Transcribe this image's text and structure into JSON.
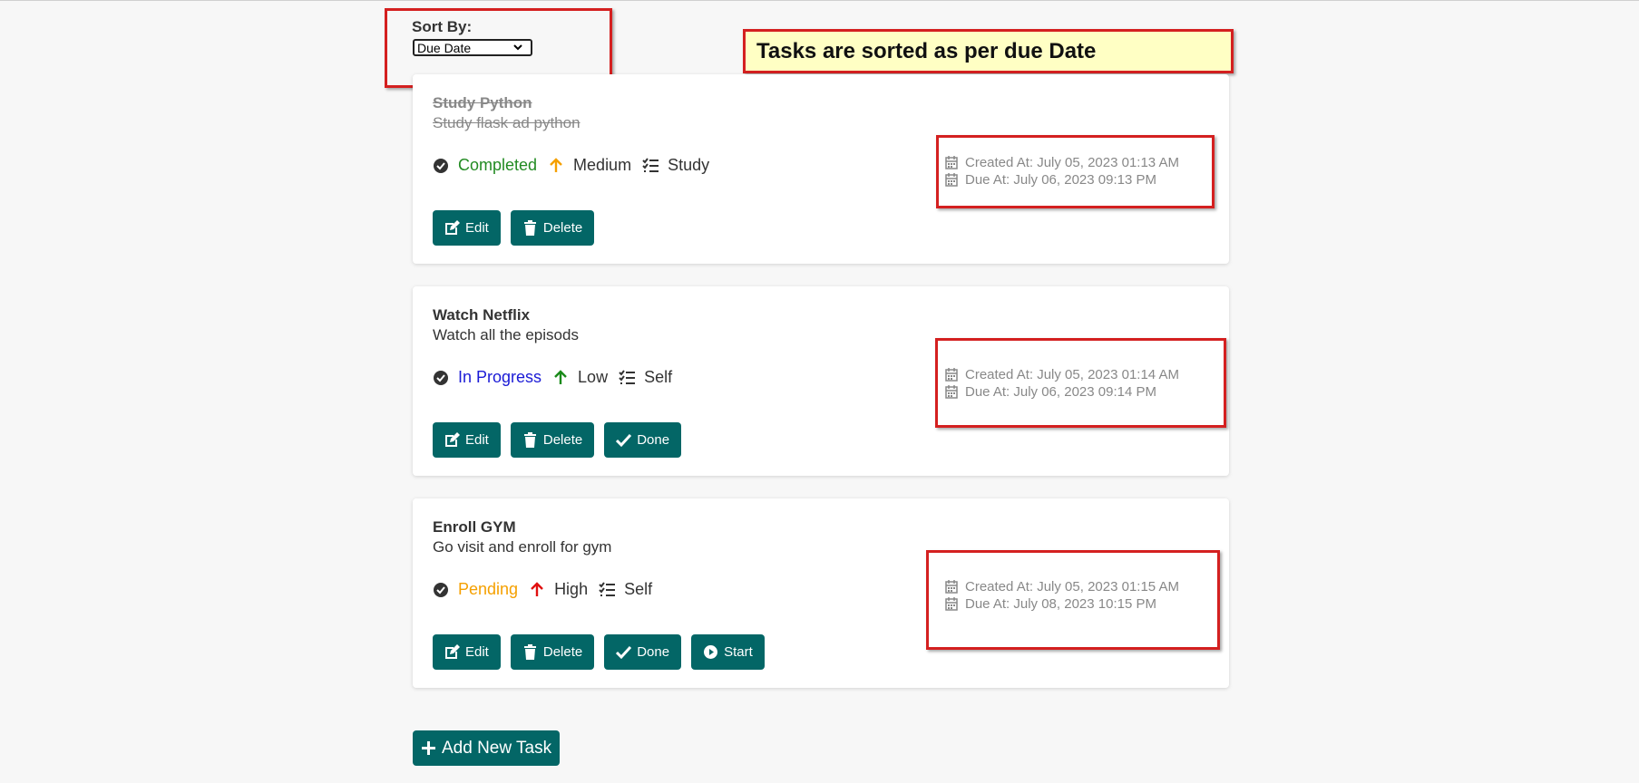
{
  "sort": {
    "label": "Sort By:",
    "selected": "Due Date"
  },
  "annotation": {
    "text": "Tasks are sorted as per due Date"
  },
  "tasks": [
    {
      "title": "Study Python",
      "description": "Study flask ad python",
      "status": "Completed",
      "status_color": "#228b22",
      "priority": "Medium",
      "priority_color": "#f5a000",
      "category": "Study",
      "created": "Created At: July 05, 2023 01:13 AM",
      "due": "Due At: July 06, 2023 09:13 PM",
      "buttons": {
        "edit": "Edit",
        "delete": "Delete"
      }
    },
    {
      "title": "Watch Netflix",
      "description": "Watch all the episods",
      "status": "In Progress",
      "status_color": "#1a1ad6",
      "priority": "Low",
      "priority_color": "#1a8a1a",
      "category": "Self",
      "created": "Created At: July 05, 2023 01:14 AM",
      "due": "Due At: July 06, 2023 09:14 PM",
      "buttons": {
        "edit": "Edit",
        "delete": "Delete",
        "done": "Done"
      }
    },
    {
      "title": "Enroll GYM",
      "description": "Go visit and enroll for gym",
      "status": "Pending",
      "status_color": "#f5a000",
      "priority": "High",
      "priority_color": "#e01010",
      "category": "Self",
      "created": "Created At: July 05, 2023 01:15 AM",
      "due": "Due At: July 08, 2023 10:15 PM",
      "buttons": {
        "edit": "Edit",
        "delete": "Delete",
        "done": "Done",
        "start": "Start"
      }
    }
  ],
  "add_button": "Add New Task",
  "colors": {
    "primary": "#036666",
    "annotation": "#d42020",
    "note_bg": "#ffffc4"
  }
}
